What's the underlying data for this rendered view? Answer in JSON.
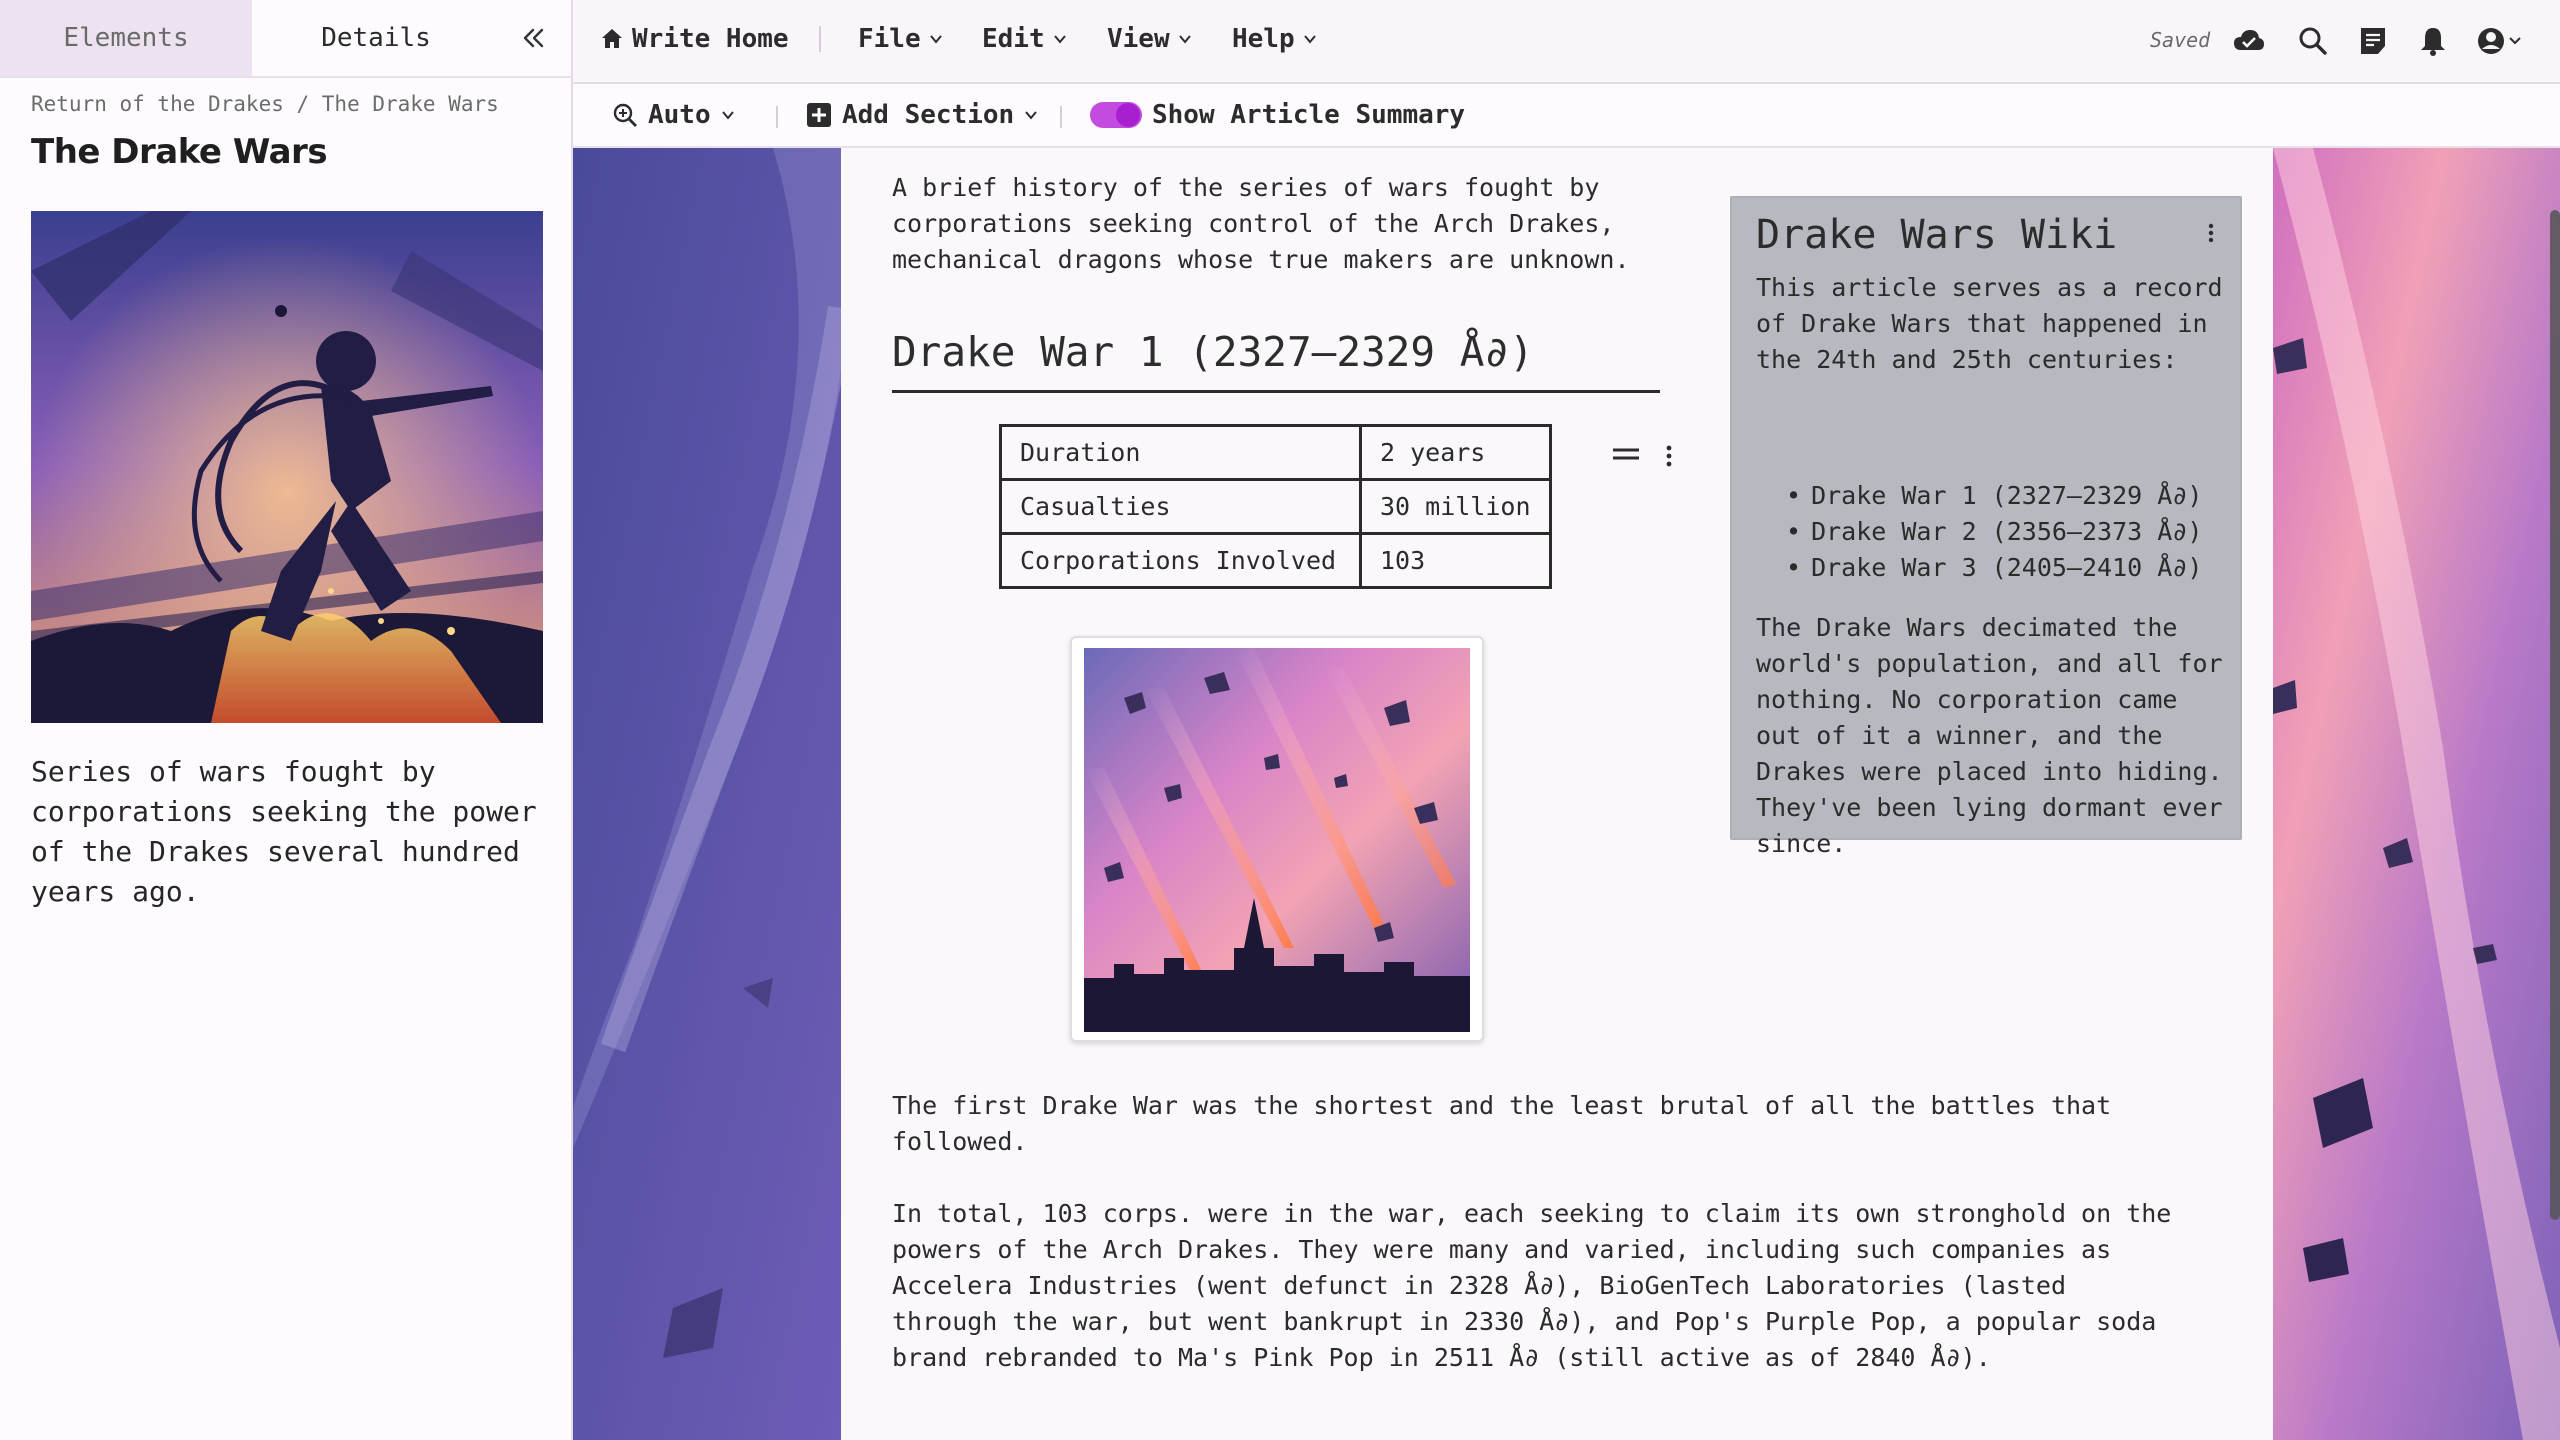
{
  "sidebar": {
    "tabs": [
      {
        "label": "Elements",
        "active": false
      },
      {
        "label": "Details",
        "active": true
      }
    ],
    "breadcrumb": "Return of the Drakes / The Drake Wars",
    "title": "The Drake Wars",
    "description": "Series of wars fought by corporations seeking the power of the Drakes several hundred years ago.",
    "collapse_icon": "chevrons-left-icon"
  },
  "topbar": {
    "home_label": "Write Home",
    "menus": [
      {
        "label": "File"
      },
      {
        "label": "Edit"
      },
      {
        "label": "View"
      },
      {
        "label": "Help"
      }
    ],
    "saved_label": "Saved",
    "icons": [
      "cloud-check-icon",
      "search-icon",
      "notes-icon",
      "bell-icon",
      "account-icon"
    ]
  },
  "toolbar": {
    "zoom_label": "Auto",
    "add_section_label": "Add Section",
    "summary_toggle_label": "Show Article Summary",
    "summary_toggle_on": true,
    "accent_color": "#c44be0"
  },
  "article": {
    "intro": "A brief history of the series of wars fought by corporations seeking control of the Arch Drakes, mechanical dragons whose true makers are unknown.",
    "heading": "Drake War 1 (2327–2329 Å∂)",
    "table": [
      {
        "key": "Duration",
        "value": "2 years"
      },
      {
        "key": "Casualties",
        "value": "30 million"
      },
      {
        "key": "Corporations Involved",
        "value": "103"
      }
    ],
    "paragraph1": "The first Drake War was the shortest and the least brutal of all the battles that followed.",
    "paragraph2": "In total, 103 corps. were in the war, each seeking to claim its own stronghold on the powers of the Arch Drakes. They were many and varied, including such companies as Accelera Industries (went defunct in 2328 Å∂), BioGenTech Laboratories (lasted through the war, but went bankrupt in 2330 Å∂), and Pop's Purple Pop, a popular soda brand rebranded to Ma's Pink Pop in 2511 Å∂ (still active as of 2840 Å∂)."
  },
  "summary": {
    "title": "Drake Wars Wiki",
    "intro": "This article serves as a record of Drake Wars that happened in the 24th and 25th centuries:",
    "items": [
      "Drake War 1 (2327–2329 Å∂)",
      "Drake War 2 (2356–2373 Å∂)",
      "Drake War 3 (2405–2410 Å∂)"
    ],
    "body": "The Drake Wars decimated the world's population, and all for nothing. No corporation came out of it a winner, and the Drakes were placed into hiding. They've been lying dormant ever since.",
    "background_color": "#b7b9c0"
  }
}
